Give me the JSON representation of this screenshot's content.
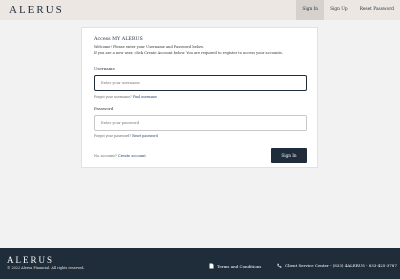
{
  "brand": {
    "logo_text": "ALERUS"
  },
  "topnav": {
    "items": [
      "Sign In",
      "Sign Up",
      "Reset Password"
    ]
  },
  "login": {
    "title": "Access MY ALERUS",
    "intro_line1": "Welcome! Please enter your Username and Password below.",
    "intro_line2": "If you are a new user, click Create Account below. You are required to register to access your accounts.",
    "username_label": "Username",
    "username_placeholder": "Enter your username",
    "forgot_username_prefix": "Forgot your username?",
    "forgot_username_link": "Find username",
    "password_label": "Password",
    "password_placeholder": "Enter your password",
    "forgot_password_prefix": "Forgot your password?",
    "forgot_password_link": "Reset password",
    "no_account_prefix": "No account?",
    "create_account_link": "Create account",
    "sign_in_button": "Sign In"
  },
  "footer": {
    "logo_text": "ALERUS",
    "copyright": "© 2022 Alerus Financial. All rights reserved.",
    "terms_label": "Terms and Conditions",
    "client_service": "Client Service Center - (833) 4ALERUS - 833-425-3787"
  },
  "colors": {
    "navy": "#1f2c3a",
    "link": "#1f3d6e",
    "topbar": "#ede7e3",
    "page_bg": "#f2f2f2"
  }
}
